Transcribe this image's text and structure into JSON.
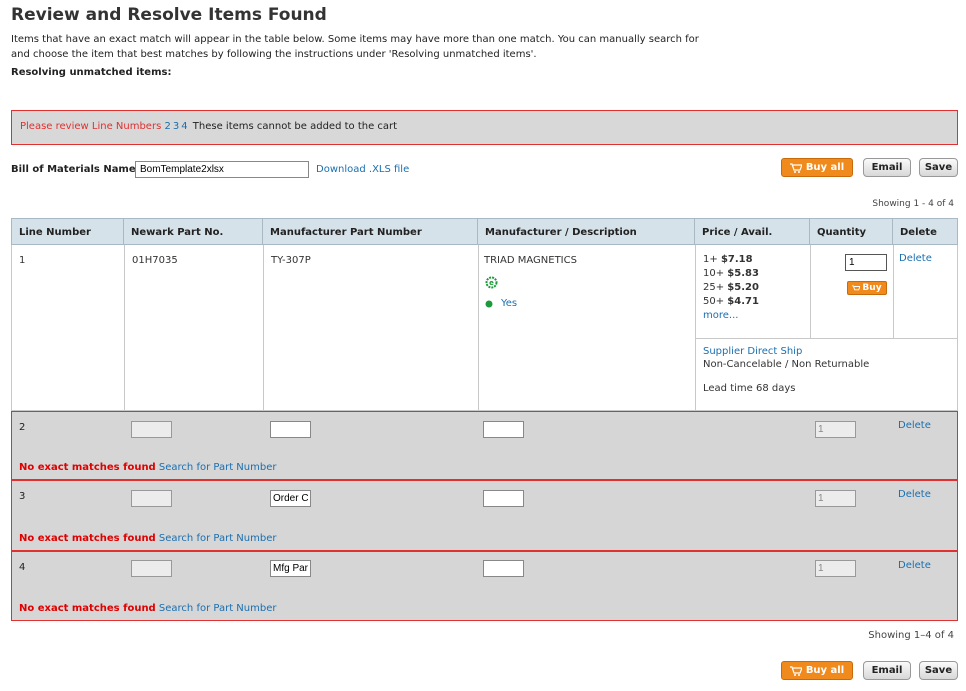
{
  "page": {
    "title": "Review and Resolve Items Found",
    "intro": "Items that have an exact match will appear in the table below. Some items may have more than one match. You can manually search for and choose the item that best matches by following the instructions under 'Resolving unmatched items'.",
    "resolving_label": "Resolving unmatched items:"
  },
  "alert": {
    "prefix": "Please review Line Numbers",
    "lines": [
      "2",
      "3",
      "4"
    ],
    "suffix": "These items cannot be added to the cart"
  },
  "bom": {
    "label": "Bill of Materials Name",
    "value": "BomTemplate2xlsx",
    "download_label": "Download .XLS file"
  },
  "actions": {
    "buy_all": "Buy all",
    "email": "Email",
    "save": "Save"
  },
  "showing_top": "Showing 1 - 4 of 4",
  "showing_bottom": "Showing 1–4 of 4",
  "table": {
    "headers": [
      "Line Number",
      "Newark Part No.",
      "Manufacturer Part Number",
      "Manufacturer / Description",
      "Price / Avail.",
      "Quantity",
      "Delete"
    ],
    "matched_row": {
      "line": "1",
      "newark_part": "01H7035",
      "mfr_part": "TY-307P",
      "manufacturer": "TRIAD MAGNETICS",
      "rohs": "Yes",
      "prices": [
        {
          "qty": "1+",
          "price": "$7.18"
        },
        {
          "qty": "10+",
          "price": "$5.83"
        },
        {
          "qty": "25+",
          "price": "$5.20"
        },
        {
          "qty": "50+",
          "price": "$4.71"
        }
      ],
      "more_label": "more...",
      "quantity": "1",
      "buy_label": "Buy",
      "delete_label": "Delete",
      "ship_link": "Supplier Direct Ship",
      "ship_note": "Non-Cancelable / Non Returnable",
      "lead_time": "Lead time 68 days"
    },
    "unmatched_rows": [
      {
        "line": "2",
        "newark": "",
        "mfr": "",
        "desc": "",
        "qty": "1",
        "delete": "Delete",
        "error": "No exact matches found",
        "search": "Search for Part Number"
      },
      {
        "line": "3",
        "newark": "",
        "mfr": "Order Code",
        "desc": "",
        "qty": "1",
        "delete": "Delete",
        "error": "No exact matches found",
        "search": "Search for Part Number"
      },
      {
        "line": "4",
        "newark": "",
        "mfr": "Mfg Part No",
        "desc": "",
        "qty": "1",
        "delete": "Delete",
        "error": "No exact matches found",
        "search": "Search for Part Number"
      }
    ]
  },
  "colors": {
    "accent_orange": "#f08a1c",
    "error_red": "#e03030",
    "link_blue": "#1a6fb0",
    "header_bg": "#d6e2ea",
    "rohs_green": "#1a9a3a"
  }
}
